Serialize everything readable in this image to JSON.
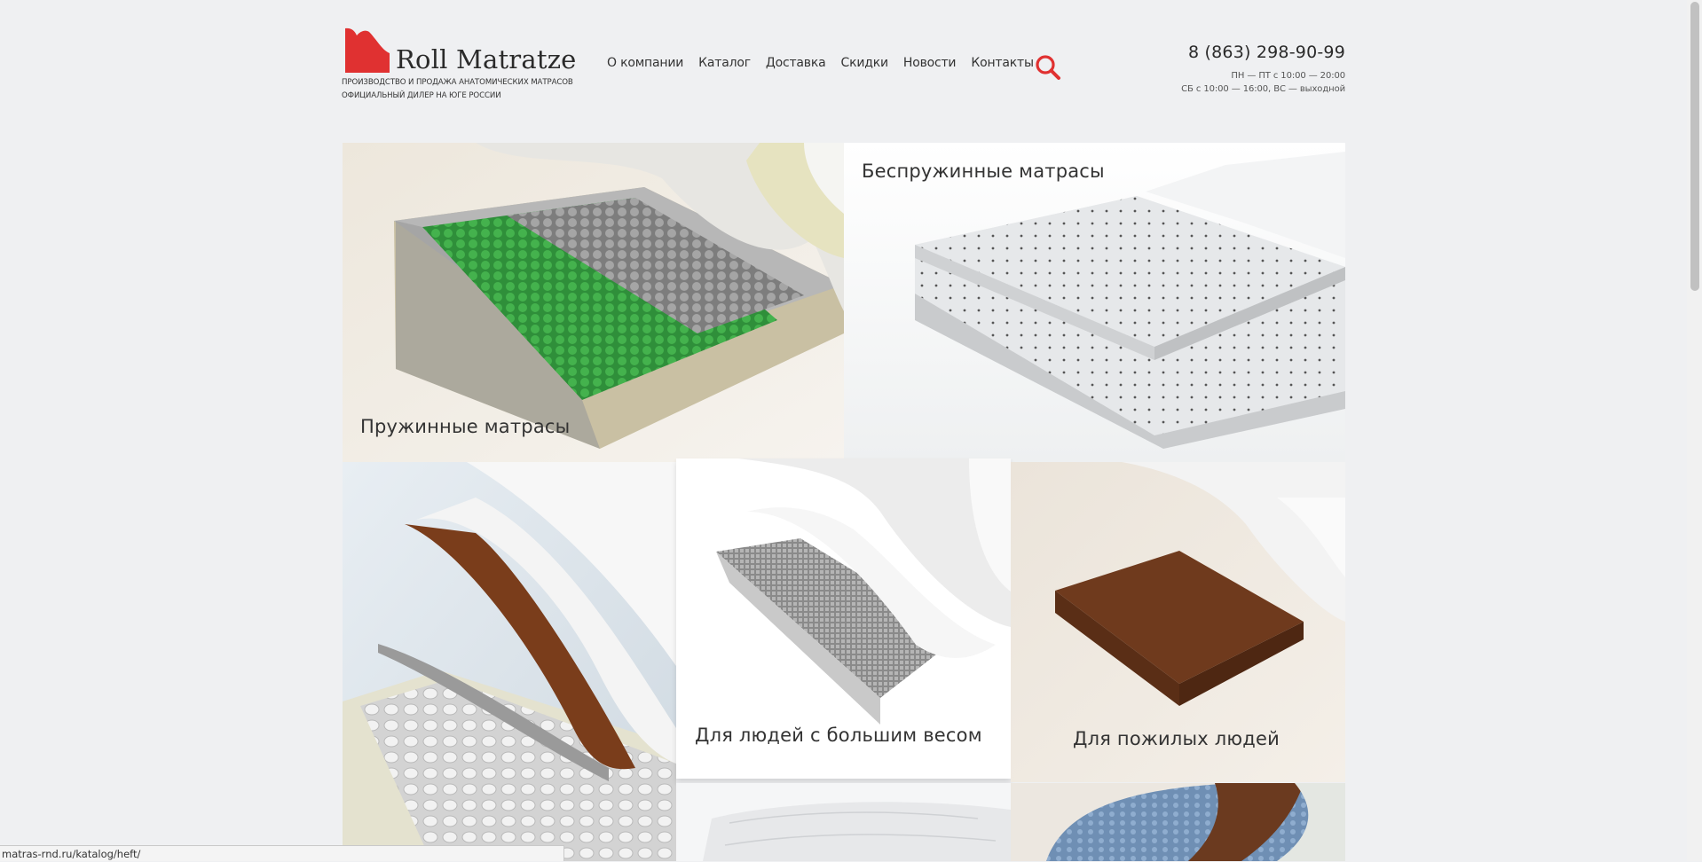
{
  "header": {
    "logo_text": "Roll Matratze",
    "tagline_1": "ПРОИЗВОДСТВО И ПРОДАЖА АНАТОМИЧЕСКИХ МАТРАСОВ",
    "tagline_2": "ОФИЦИАЛЬНЫЙ ДИЛЕР НА ЮГЕ РОССИИ",
    "nav": [
      "О компании",
      "Каталог",
      "Доставка",
      "Скидки",
      "Новости",
      "Контакты"
    ],
    "search_icon": "search-icon",
    "phone": "8 (863) 298-90-99",
    "hours_1": "ПН — ПТ с 10:00 — 20:00",
    "hours_2": "СБ с 10:00 — 16:00, ВС — выходной"
  },
  "tiles": [
    {
      "label": "Пружинные матрасы"
    },
    {
      "label": "Беспружинные матрасы"
    },
    {
      "label": "Для людей с большим весом"
    },
    {
      "label": "Для пожилых людей"
    }
  ],
  "status_bar": {
    "url": "matras-rnd.ru/katalog/heft/"
  },
  "colors": {
    "brand_red": "#e03131",
    "background": "#eff0f2",
    "spring_green": "#3aa544",
    "latex_brown": "#7a3d1b"
  }
}
